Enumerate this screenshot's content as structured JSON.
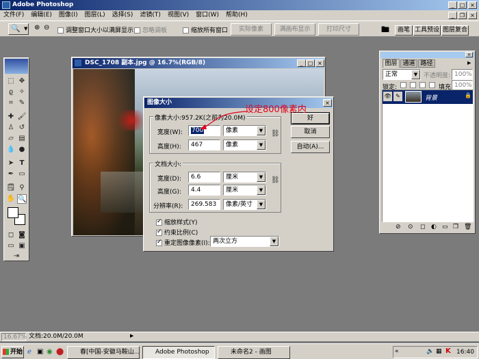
{
  "app": {
    "title": "Adobe Photoshop"
  },
  "menu": [
    "文件(F)",
    "编辑(E)",
    "图像(I)",
    "图层(L)",
    "选择(S)",
    "滤镜(T)",
    "视图(V)",
    "窗口(W)",
    "帮助(H)"
  ],
  "options_bar": {
    "fit_window": "调整窗口大小以满屏显示",
    "ignore_palettes": "忽略调板",
    "zoom_all": "缩放所有窗口",
    "actual_pixels": "实际像素",
    "fit_screen": "满画布显示",
    "print_size": "打印尺寸",
    "tab_brushes": "画笔",
    "tab_presets": "工具预设",
    "tab_comps": "图层复合"
  },
  "doc_window": {
    "title": "DSC_1708 副本.jpg @ 16.7%(RGB/8)"
  },
  "dialog": {
    "title": "图像大小",
    "pixel_dims_label": "像素大小:957.2K(之前为20.0M)",
    "width_label": "宽度(W):",
    "width_value": "700",
    "width_unit": "像素",
    "height_label": "高度(H):",
    "height_value": "467",
    "height_unit": "像素",
    "doc_size_label": "文档大小:",
    "doc_width_label": "宽度(D):",
    "doc_width_value": "6.6",
    "doc_width_unit": "厘米",
    "doc_height_label": "高度(G):",
    "doc_height_value": "4.4",
    "doc_height_unit": "厘米",
    "resolution_label": "分辨率(R):",
    "resolution_value": "269.583",
    "resolution_unit": "像素/英寸",
    "scale_styles": "缩放样式(Y)",
    "constrain": "约束比例(C)",
    "resample": "重定图像像素(I):",
    "resample_method": "两次立方",
    "ok": "好",
    "cancel": "取消",
    "auto": "自动(A)..."
  },
  "annotation": "设定800像素内",
  "layers_panel": {
    "tab_layers": "图层",
    "tab_channels": "通道",
    "tab_paths": "路径",
    "blend_mode": "正常",
    "opacity_label": "不透明度:",
    "opacity_value": "100%",
    "lock_label": "锁定:",
    "fill_label": "填充:",
    "fill_value": "100%",
    "layer_name": "背景"
  },
  "status_bar": {
    "zoom": "16.67%",
    "doc": "文档:20.0M/20.0M"
  },
  "taskbar": {
    "start": "开始",
    "items": [
      "春[中国-安徽马鞍山...",
      "Adobe Photoshop",
      "未命名2 - 画图"
    ],
    "clock": "16:40"
  },
  "colors": {
    "title_blue": "#0a246a",
    "annotation_red": "#e0001a",
    "workspace": "#7b7b7b"
  }
}
